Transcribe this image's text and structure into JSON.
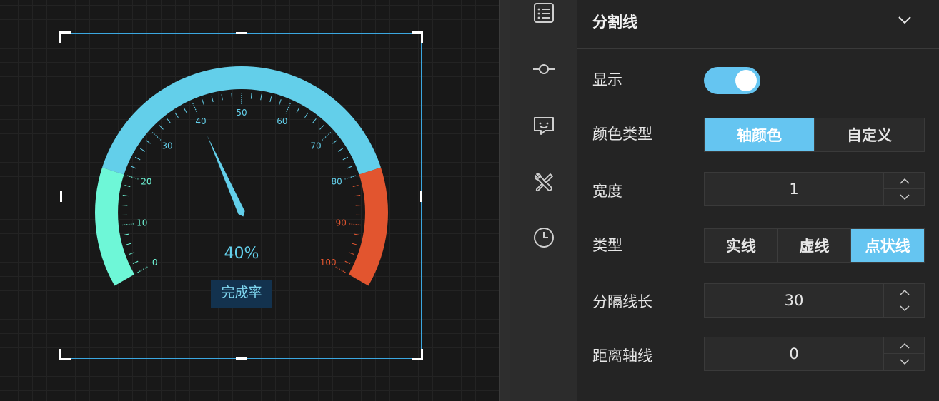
{
  "canvas": {
    "gauge": {
      "value_text": "40%",
      "label": "完成率",
      "ticks": [
        "0",
        "10",
        "20",
        "30",
        "40",
        "50",
        "60",
        "70",
        "80",
        "90",
        "100"
      ],
      "min": 0,
      "max": 100,
      "value": 40,
      "start_angle_deg": 210,
      "end_angle_deg": -30,
      "band_colors": {
        "low": "#6ef7d7",
        "mid": "#63cfea",
        "high": "#e2552f"
      },
      "bands": [
        {
          "from": 0,
          "to": 20,
          "color": "low"
        },
        {
          "from": 20,
          "to": 80,
          "color": "mid"
        },
        {
          "from": 80,
          "to": 100,
          "color": "high"
        }
      ],
      "pointer_color": "#63cfea"
    }
  },
  "rail": {
    "icons": [
      "list-icon",
      "commit-icon",
      "message-icon",
      "tools-icon",
      "clock-icon"
    ]
  },
  "panel": {
    "title": "分割线",
    "rows": {
      "show": {
        "label": "显示",
        "on": true
      },
      "color_type": {
        "label": "颜色类型",
        "options": [
          "轴颜色",
          "自定义"
        ],
        "selected": 0
      },
      "width": {
        "label": "宽度",
        "value": "1"
      },
      "type": {
        "label": "类型",
        "options": [
          "实线",
          "虚线",
          "点状线"
        ],
        "selected": 2
      },
      "split_length": {
        "label": "分隔线长",
        "value": "30"
      },
      "axis_distance": {
        "label": "距离轴线",
        "value": "0"
      }
    }
  },
  "colors": {
    "accent": "#65c5f1",
    "selection_border": "#3ba7e0"
  }
}
